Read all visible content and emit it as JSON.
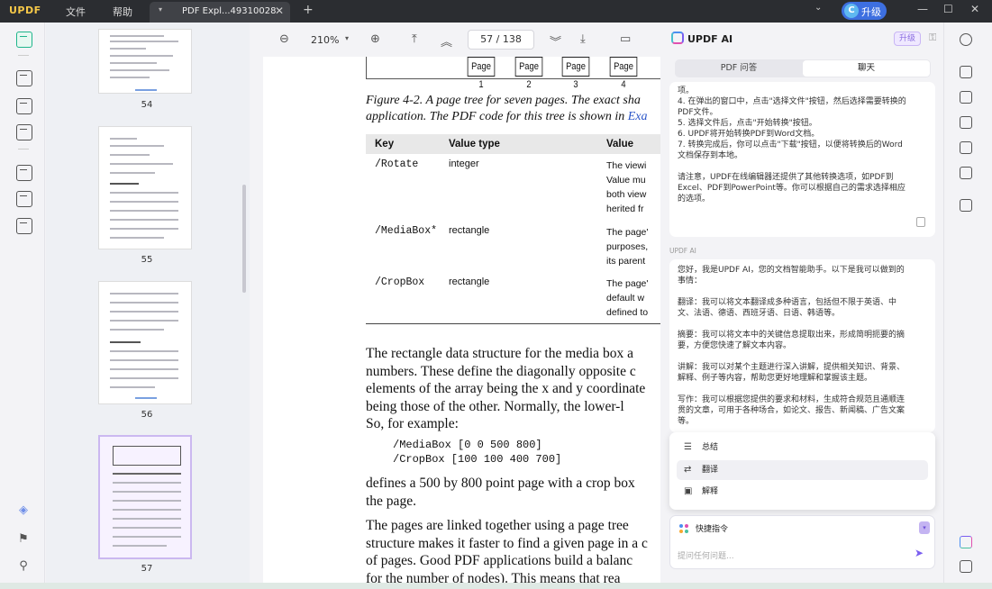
{
  "titlebar": {
    "logo_a": "UPD",
    "logo_b": "F",
    "menu_file": "文件",
    "menu_help": "帮助",
    "tab_name": "PDF Expl...49310028",
    "tab_close": "✕",
    "new_tab": "+",
    "upgrade_icon": "C",
    "upgrade_label": "升级",
    "minimize": "—",
    "maximize": "☐",
    "close": "✕",
    "dropdown": "⌄"
  },
  "thumbnails": [
    {
      "page": "54"
    },
    {
      "page": "55"
    },
    {
      "page": "56"
    },
    {
      "page": "57"
    }
  ],
  "doc_toolbar": {
    "zoom_out": "⊖",
    "zoom": "210%",
    "zoom_caret": "▾",
    "zoom_in": "⊕",
    "first_page": "⤒",
    "prev_page": "︽",
    "page_indicator": "57  /  138",
    "next_page": "︾",
    "last_page": "⤓",
    "comment": "▭"
  },
  "page": {
    "tree_boxes": [
      "Page 1",
      "Page 2",
      "Page 3",
      "Page 4"
    ],
    "caption_line1": "Figure 4-2. A page tree for seven pages. The exact sha",
    "caption_line2_a": "application. The PDF code for this tree is shown in ",
    "caption_line2_link": "Exa",
    "table_headers": [
      "Key",
      "Value type",
      "Value"
    ],
    "table_rows": [
      {
        "key": "/Rotate",
        "type": "integer",
        "desc": [
          "The viewi",
          "Value mu",
          "both view",
          "herited fr"
        ]
      },
      {
        "key": "/MediaBox*",
        "type": "rectangle",
        "desc": [
          "The page'",
          "purposes,",
          "its parent"
        ]
      },
      {
        "key": "/CropBox",
        "type": "rectangle",
        "desc": [
          "The page'",
          "default w",
          "defined to"
        ]
      }
    ],
    "para1": [
      "The rectangle data structure for the media box a",
      "numbers. These define the diagonally opposite c",
      "elements of the array being the x and y coordinate",
      "being those of the other. Normally, the lower-l",
      "So, for example:"
    ],
    "code": [
      "/MediaBox [0 0 500 800]",
      "/CropBox [100 100 400 700]"
    ],
    "para2": [
      "defines a 500 by 800 point page with a crop box",
      "the page."
    ],
    "para3": [
      "The pages are linked together using a page tree",
      "structure makes it faster to find a given page in a c",
      "of pages. Good PDF applications build a balanc",
      "for the number of nodes). This means that rea"
    ]
  },
  "ai": {
    "title": "UPDF AI",
    "upgrade_badge": "升级",
    "tab_qa": "PDF 问答",
    "tab_chat": "聊天",
    "card1": [
      "项。",
      "4. 在弹出的窗口中，点击\"选择文件\"按钮，然后选择需要转换的",
      "PDF文件。",
      "5. 选择文件后，点击\"开始转换\"按钮。",
      "6. UPDF将开始转换PDF到Word文档。",
      "7. 转换完成后，你可以点击\"下载\"按钮，以便将转换后的Word",
      "文档保存到本地。",
      "",
      "请注意，UPDF在线编辑器还提供了其他转换选项，如PDF到",
      "Excel、PDF到PowerPoint等。你可以根据自己的需求选择相应",
      "的选项。"
    ],
    "sender_label": "UPDF AI",
    "card2": [
      "您好，我是UPDF AI，您的文档智能助手。以下是我可以做到的",
      "事情：",
      "",
      "翻译：我可以将文本翻译成多种语言，包括但不限于英语、中",
      "文、法语、德语、西班牙语、日语、韩语等。",
      "",
      "摘要：我可以将文本中的关键信息提取出来，形成简明扼要的摘",
      "要，方便您快速了解文本内容。",
      "",
      "讲解：我可以对某个主题进行深入讲解，提供相关知识、背景、",
      "解释、例子等内容，帮助您更好地理解和掌握该主题。",
      "",
      "写作：我可以根据您提供的要求和材料，生成符合规范且通顺连",
      "贯的文章，可用于各种场合，如论文、报告、新闻稿、广告文案",
      "等。"
    ],
    "menu": [
      {
        "icon": "☰",
        "label": "总结"
      },
      {
        "icon": "⇄",
        "label": "翻译"
      },
      {
        "icon": "▣",
        "label": "解释"
      }
    ],
    "quick_label": "快捷指令",
    "quick_btn": "▾",
    "input_placeholder": "提问任何问题...",
    "send": "➤"
  }
}
